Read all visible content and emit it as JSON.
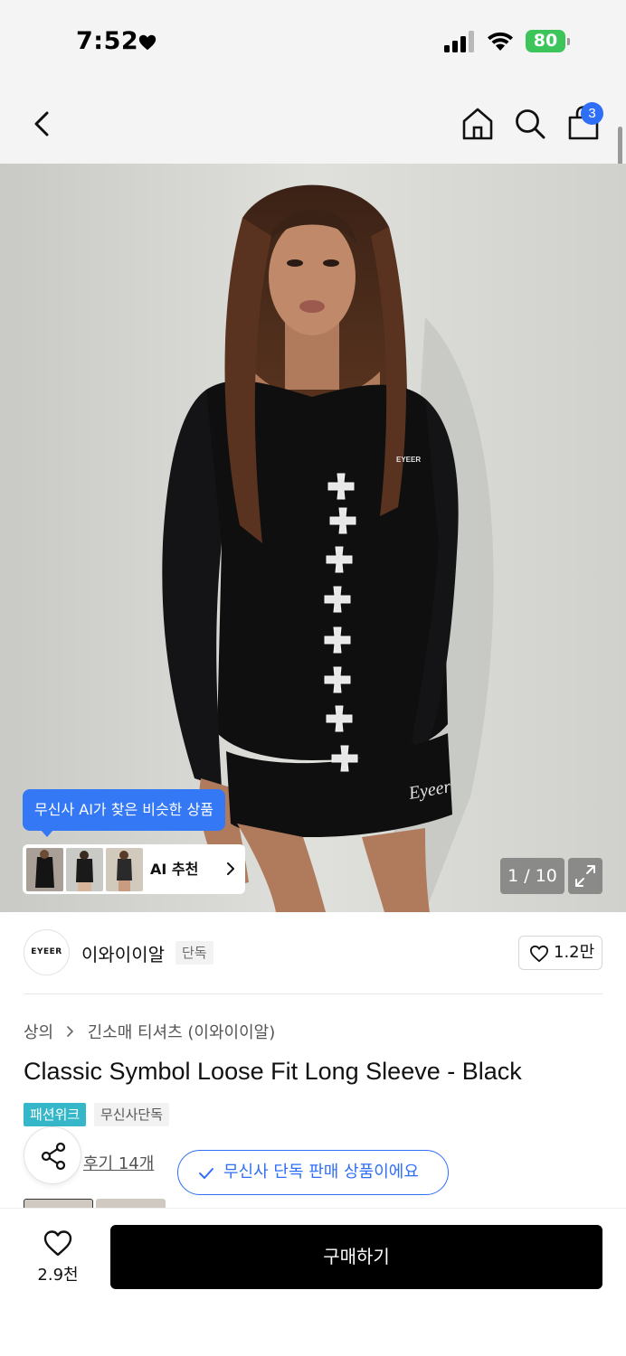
{
  "status_bar": {
    "time": "7:52",
    "battery": "80",
    "icons": [
      "heart-icon",
      "signal-icon",
      "wifi-icon",
      "battery-charging-icon"
    ]
  },
  "nav": {
    "icons": [
      "chevron-left-icon",
      "home-icon",
      "search-icon",
      "shopping-bag-icon"
    ],
    "cart_badge": "3"
  },
  "hero": {
    "brand_chest_text": "EYEER",
    "shorts_script_text": "Eyeer",
    "ai_tooltip": "무신사 AI가 찾은 비슷한 상품",
    "ai_recommend_label": "AI 추천",
    "image_counter": "1 / 10"
  },
  "brand": {
    "logo_text": "EYEER",
    "name": "이와이이알",
    "tag": "단독",
    "like_count": "1.2만"
  },
  "product": {
    "breadcrumb": [
      "상의",
      "긴소매 티셔츠 (이와이이알)"
    ],
    "title": "Classic Symbol Loose Fit Long Sleeve - Black",
    "badges": [
      "패션위크",
      "무신사단독"
    ],
    "review_link": "후기 14개",
    "exclusive_notice": "무신사 단독 판매 상품이에요"
  },
  "bottom_bar": {
    "wish_count": "2.9천",
    "buy_label": "구매하기"
  },
  "colors": {
    "accent_blue": "#2f6ef7",
    "tooltip_blue": "#3478f6",
    "fashion_week_teal": "#35b7c9",
    "battery_green": "#3dc55b",
    "buy_button": "#000000"
  }
}
